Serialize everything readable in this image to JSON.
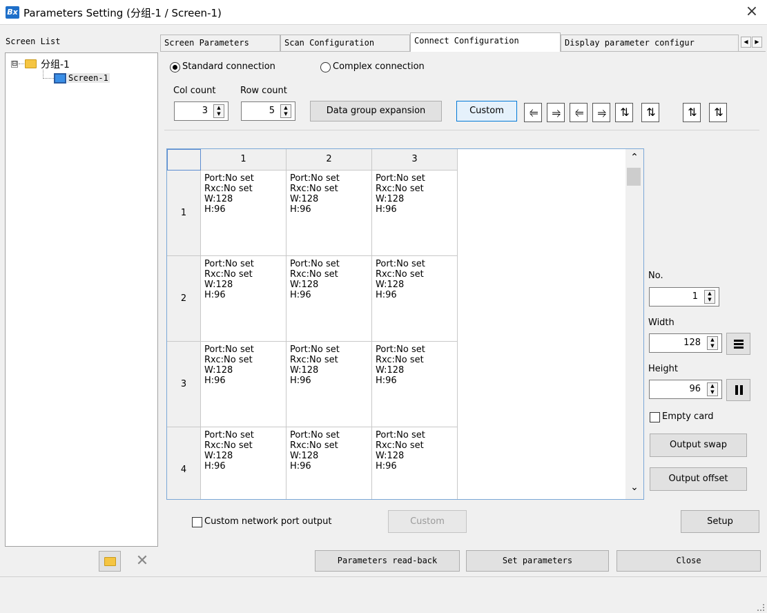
{
  "window": {
    "title": "Parameters Setting  (分组-1 / Screen-1)",
    "logo_text": "Bx",
    "close_glyph": "×"
  },
  "sidebar": {
    "label": "Screen List",
    "group": {
      "name": "分组-1",
      "expander": "⊟",
      "icon": "folder-icon"
    },
    "screen": {
      "name": "Screen-1",
      "icon": "monitor-icon"
    },
    "toolbar": {
      "folder_icon": "folder-icon",
      "delete_icon": "close-icon",
      "delete_glyph": "✕"
    }
  },
  "tabs": [
    {
      "label": "Screen Parameters"
    },
    {
      "label": "Scan Configuration"
    },
    {
      "label": "Connect Configuration"
    },
    {
      "label": "Display parameter configur"
    }
  ],
  "tab_arrows": {
    "left": "◀",
    "right": "▶"
  },
  "connection": {
    "standard": "Standard connection",
    "complex": "Complex connection",
    "selected": "standard"
  },
  "counts": {
    "col_label": "Col count",
    "col_value": "3",
    "row_label": "Row count",
    "row_value": "5"
  },
  "buttons": {
    "data_group_expansion": "Data group expansion",
    "custom": "Custom"
  },
  "spin_glyphs": {
    "up": "▲",
    "down": "▼"
  },
  "direction_icons": [
    "⥢",
    "⥤",
    "⥢",
    "⥤",
    "⇅",
    "⇅",
    "⇅",
    "⇅"
  ],
  "grid": {
    "columns": [
      "1",
      "2",
      "3"
    ],
    "rows": [
      {
        "label": "1",
        "cells": [
          "Port:No set\nRxc:No set\nW:128\nH:96",
          "Port:No set\nRxc:No set\nW:128\nH:96",
          "Port:No set\nRxc:No set\nW:128\nH:96"
        ]
      },
      {
        "label": "2",
        "cells": [
          "Port:No set\nRxc:No set\nW:128\nH:96",
          "Port:No set\nRxc:No set\nW:128\nH:96",
          "Port:No set\nRxc:No set\nW:128\nH:96"
        ]
      },
      {
        "label": "3",
        "cells": [
          "Port:No set\nRxc:No set\nW:128\nH:96",
          "Port:No set\nRxc:No set\nW:128\nH:96",
          "Port:No set\nRxc:No set\nW:128\nH:96"
        ]
      },
      {
        "label": "4",
        "cells": [
          "Port:No set\nRxc:No set\nW:128\nH:96",
          "Port:No set\nRxc:No set\nW:128\nH:96",
          "Port:No set\nRxc:No set\nW:128\nH:96"
        ]
      }
    ],
    "scroll_up": "⌃",
    "scroll_down": "⌄"
  },
  "side_panel": {
    "no_label": "No.",
    "no_value": "1",
    "width_label": "Width",
    "width_value": "128",
    "height_label": "Height",
    "height_value": "96",
    "empty_card": "Empty card",
    "output_swap": "Output swap",
    "output_offset": "Output offset"
  },
  "footer": {
    "custom_port_output": "Custom network port output",
    "custom_button": "Custom",
    "setup": "Setup",
    "read_back": "Parameters read-back",
    "set_parameters": "Set parameters",
    "close": "Close"
  }
}
